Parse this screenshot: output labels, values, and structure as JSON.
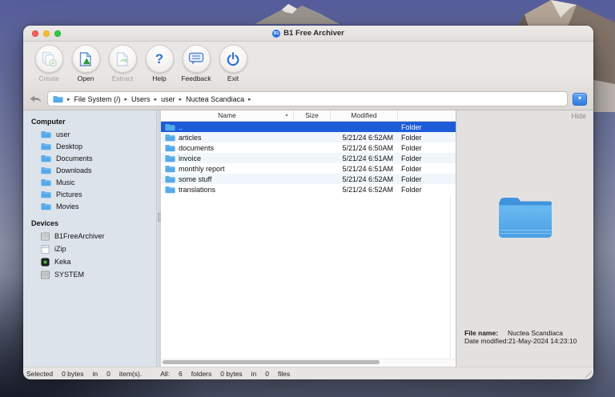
{
  "window": {
    "title": "B1 Free Archiver",
    "badge": "B1"
  },
  "toolbar": {
    "buttons": [
      {
        "label": "Create",
        "disabled": true
      },
      {
        "label": "Open",
        "disabled": false
      },
      {
        "label": "Extract",
        "disabled": true
      },
      {
        "label": "Help",
        "disabled": false,
        "glyph": "?"
      },
      {
        "label": "Feedback",
        "disabled": false
      },
      {
        "label": "Exit",
        "disabled": false
      }
    ]
  },
  "pathbar": {
    "segments": [
      "File System (/)",
      "Users",
      "user",
      "Nuctea Scandiaca"
    ],
    "separator": "▸",
    "dropdown_glyph": "▾"
  },
  "sidebar": {
    "computer": {
      "header": "Computer",
      "items": [
        {
          "label": "user"
        },
        {
          "label": "Desktop"
        },
        {
          "label": "Documents"
        },
        {
          "label": "Downloads"
        },
        {
          "label": "Music"
        },
        {
          "label": "Pictures"
        },
        {
          "label": "Movies"
        }
      ]
    },
    "devices": {
      "header": "Devices",
      "items": [
        {
          "label": "B1FreeArchiver"
        },
        {
          "label": "iZip"
        },
        {
          "label": "Keka"
        },
        {
          "label": "SYSTEM"
        }
      ]
    }
  },
  "filelist": {
    "columns": {
      "name": "Name",
      "size": "Size",
      "modified": "Modified"
    },
    "sort_glyph": "▲",
    "rows": [
      {
        "name": "..",
        "size": "",
        "modified": "",
        "type": "Folder",
        "selected": true
      },
      {
        "name": "articles",
        "size": "",
        "modified": "5/21/24 6:52AM",
        "type": "Folder",
        "selected": false
      },
      {
        "name": "documents",
        "size": "",
        "modified": "5/21/24 6:50AM",
        "type": "Folder",
        "selected": false
      },
      {
        "name": "invoice",
        "size": "",
        "modified": "5/21/24 6:51AM",
        "type": "Folder",
        "selected": false
      },
      {
        "name": "monthly report",
        "size": "",
        "modified": "5/21/24 6:51AM",
        "type": "Folder",
        "selected": false
      },
      {
        "name": "some stuff",
        "size": "",
        "modified": "5/21/24 6:52AM",
        "type": "Folder",
        "selected": false
      },
      {
        "name": "translations",
        "size": "",
        "modified": "5/21/24 6:52AM",
        "type": "Folder",
        "selected": false
      }
    ]
  },
  "preview": {
    "hide_label": "Hide",
    "file_name_label": "File name:",
    "file_name": "Nuctea Scandiaca",
    "date_modified_label": "Date modified:",
    "date_modified": "21-May-2024 14:23:10"
  },
  "statusbar": {
    "segments": [
      "Selected",
      "0 bytes",
      "in",
      "0",
      "item(s).",
      "All:",
      "6",
      "folders",
      "0 bytes",
      "in",
      "0",
      "files"
    ]
  },
  "colors": {
    "selection_blue": "#1d5cd9",
    "folder_blue": "#55aae9",
    "accent_blue": "#2f7ce0",
    "toolbar_icon_blue": "#2e6fd0",
    "toolbar_icon_green": "#3fae4c"
  }
}
